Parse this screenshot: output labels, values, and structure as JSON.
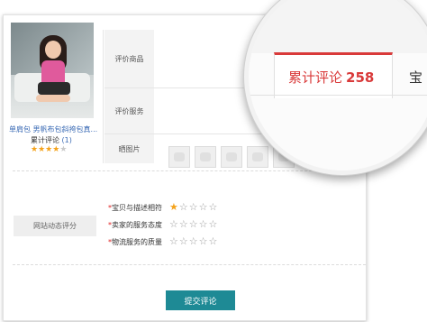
{
  "product": {
    "name": "单肩包 男帆布包斜挎包真...",
    "rating_label": "累计评论",
    "rating_count": "(1)",
    "rating_stars": 4,
    "rating_max": 5
  },
  "rows": {
    "product_review_label": "评价商品",
    "service_review_label": "评价服务",
    "photos_label": "晒图片"
  },
  "dsr": {
    "title": "网站动态评分",
    "items": [
      {
        "required": "*",
        "label": "宝贝与描述相符",
        "stars": 1
      },
      {
        "required": "*",
        "label": "卖家的服务态度",
        "stars": 0
      },
      {
        "required": "*",
        "label": "物流服务的质量",
        "stars": 0
      }
    ]
  },
  "submit_label": "提交评论",
  "magnifier": {
    "tab_label": "累计评论",
    "tab_count": "258",
    "next_tab_partial": "宝"
  },
  "colors": {
    "accent": "#d93a3a",
    "submit_bg": "#1e8a95",
    "link": "#3b6bb5",
    "star_on": "#f4a21a"
  }
}
